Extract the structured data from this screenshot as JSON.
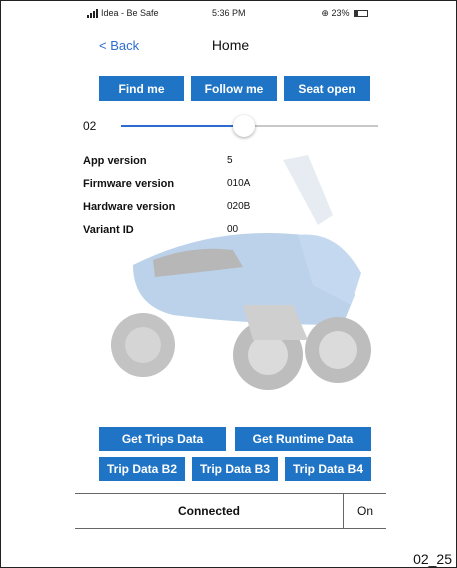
{
  "status_bar": {
    "carrier": "Idea - Be Safe",
    "time": "5:36 PM",
    "battery": "23%"
  },
  "nav": {
    "back_label": "< Back",
    "title": "Home"
  },
  "top_buttons": {
    "find_me": "Find me",
    "follow_me": "Follow me",
    "seat_open": "Seat open"
  },
  "slider": {
    "label": "02",
    "value_fraction": 0.48
  },
  "info": {
    "rows": [
      {
        "key": "App version",
        "value": "5"
      },
      {
        "key": "Firmware version",
        "value": "010A"
      },
      {
        "key": "Hardware version",
        "value": "020B"
      },
      {
        "key": "Variant ID",
        "value": "00"
      }
    ]
  },
  "data_buttons": {
    "get_trips": "Get Trips Data",
    "get_runtime": "Get Runtime Data",
    "trip_b2": "Trip Data B2",
    "trip_b3": "Trip Data B3",
    "trip_b4": "Trip Data B4"
  },
  "connection": {
    "status": "Connected",
    "toggle": "On"
  },
  "caption": "02_25",
  "colors": {
    "button_blue": "#1f74c5",
    "link_blue": "#2e6bd1"
  }
}
